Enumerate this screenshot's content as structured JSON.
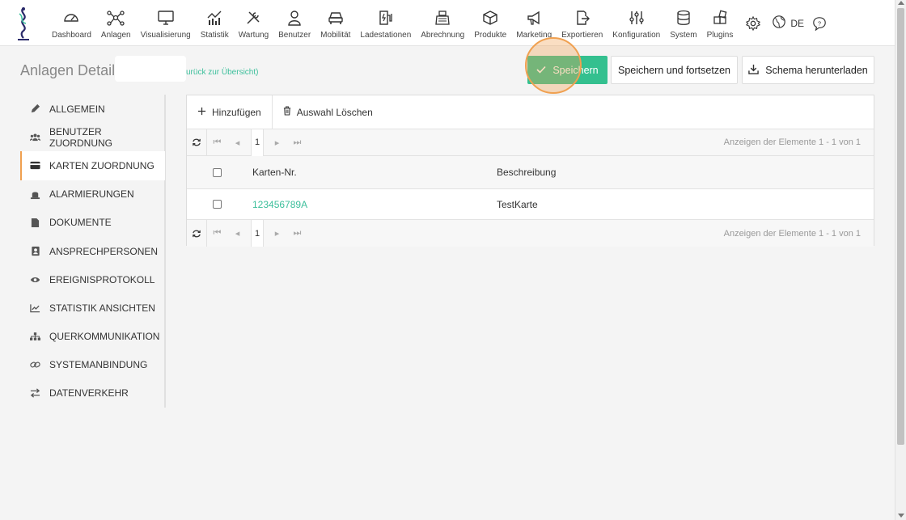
{
  "nav": {
    "items": [
      {
        "label": "Dashboard",
        "icon": "dashboard-gauge-icon"
      },
      {
        "label": "Anlagen",
        "icon": "network-nodes-icon"
      },
      {
        "label": "Visualisierung",
        "icon": "monitor-icon"
      },
      {
        "label": "Statistik",
        "icon": "chart-icon"
      },
      {
        "label": "Wartung",
        "icon": "tools-icon"
      },
      {
        "label": "Benutzer",
        "icon": "user-icon"
      },
      {
        "label": "Mobilität",
        "icon": "car-icon"
      },
      {
        "label": "Ladestationen",
        "icon": "charging-station-icon"
      },
      {
        "label": "Abrechnung",
        "icon": "cash-register-icon"
      },
      {
        "label": "Produkte",
        "icon": "box-icon"
      },
      {
        "label": "Marketing",
        "icon": "megaphone-icon"
      },
      {
        "label": "Exportieren",
        "icon": "export-icon"
      },
      {
        "label": "Konfiguration",
        "icon": "sliders-icon"
      },
      {
        "label": "System",
        "icon": "database-icon"
      },
      {
        "label": "Plugins",
        "icon": "puzzle-icon"
      }
    ],
    "language": "DE"
  },
  "header": {
    "title": "Anlagen Details",
    "back_link": "urück zur Übersicht)",
    "save_label": "Speichern",
    "save_continue_label": "Speichern und fortsetzen",
    "schema_label": "Schema herunterladen"
  },
  "sidebar": {
    "items": [
      {
        "label": "ALLGEMEIN",
        "icon": "pencil-icon"
      },
      {
        "label": "BENUTZER ZUORDNUNG",
        "icon": "users-icon"
      },
      {
        "label": "KARTEN ZUORDNUNG",
        "icon": "credit-card-icon",
        "active": true
      },
      {
        "label": "ALARMIERUNGEN",
        "icon": "alarm-icon"
      },
      {
        "label": "DOKUMENTE",
        "icon": "file-icon"
      },
      {
        "label": "ANSPRECHPERSONEN",
        "icon": "contact-card-icon"
      },
      {
        "label": "EREIGNISPROTOKOLL",
        "icon": "eye-icon"
      },
      {
        "label": "STATISTIK ANSICHTEN",
        "icon": "line-chart-icon"
      },
      {
        "label": "QUERKOMMUNIKATION",
        "icon": "sitemap-icon"
      },
      {
        "label": "SYSTEMANBINDUNG",
        "icon": "link-icon"
      },
      {
        "label": "DATENVERKEHR",
        "icon": "exchange-icon"
      }
    ]
  },
  "grid": {
    "add_label": "Hinzufügen",
    "delete_label": "Auswahl Löschen",
    "page": "1",
    "info_top": "Anzeigen der Elemente 1 - 1 von 1",
    "info_bottom": "Anzeigen der Elemente 1 - 1 von 1",
    "columns": [
      "Karten-Nr.",
      "Beschreibung"
    ],
    "rows": [
      {
        "number": "123456789A",
        "description": "TestKarte"
      }
    ]
  },
  "colors": {
    "accent": "#3cbf9b",
    "save_button": "#34c08f",
    "active_marker": "#f0a050"
  }
}
